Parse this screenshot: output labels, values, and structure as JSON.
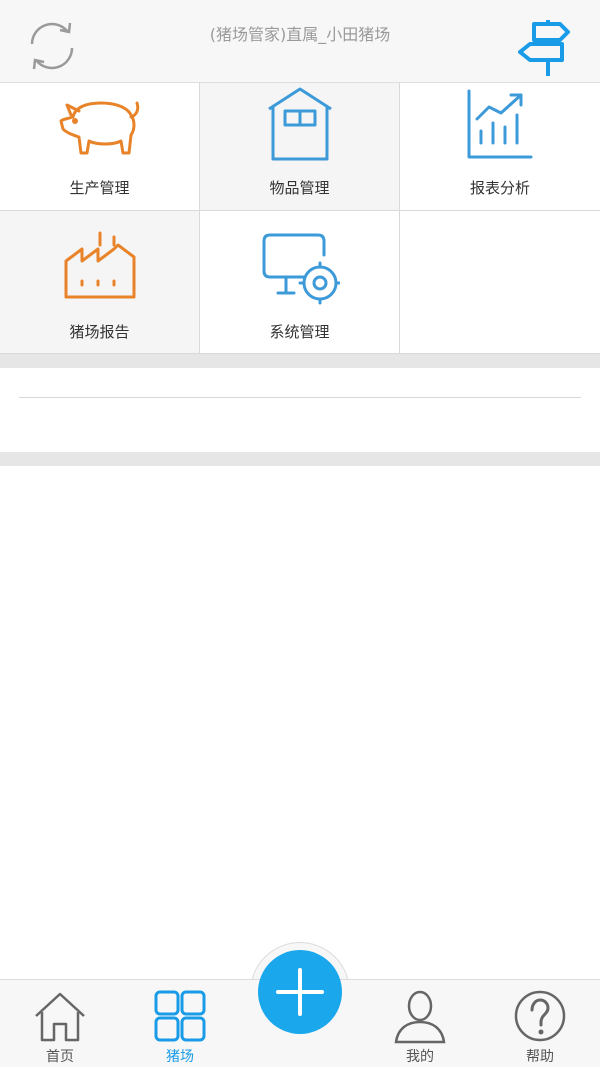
{
  "header": {
    "title": "(猪场管家)直属_小田猪场",
    "refresh_icon": "refresh-icon",
    "signpost_icon": "signpost-icon"
  },
  "menu": {
    "items": [
      {
        "label": "生产管理",
        "icon": "pig-icon"
      },
      {
        "label": "物品管理",
        "icon": "warehouse-icon"
      },
      {
        "label": "报表分析",
        "icon": "bar-chart-icon"
      },
      {
        "label": "猪场报告",
        "icon": "factory-icon"
      },
      {
        "label": "系统管理",
        "icon": "monitor-gear-icon"
      }
    ]
  },
  "tabs": [
    {
      "label": "首页",
      "icon": "home-icon"
    },
    {
      "label": "猪场",
      "icon": "grid-icon",
      "active": true
    },
    {
      "label": "我的",
      "icon": "user-icon"
    },
    {
      "label": "帮助",
      "icon": "help-icon"
    }
  ],
  "colors": {
    "accent": "#1a9be8",
    "orange": "#e8832a",
    "blue_icon": "#3d9ad9"
  }
}
